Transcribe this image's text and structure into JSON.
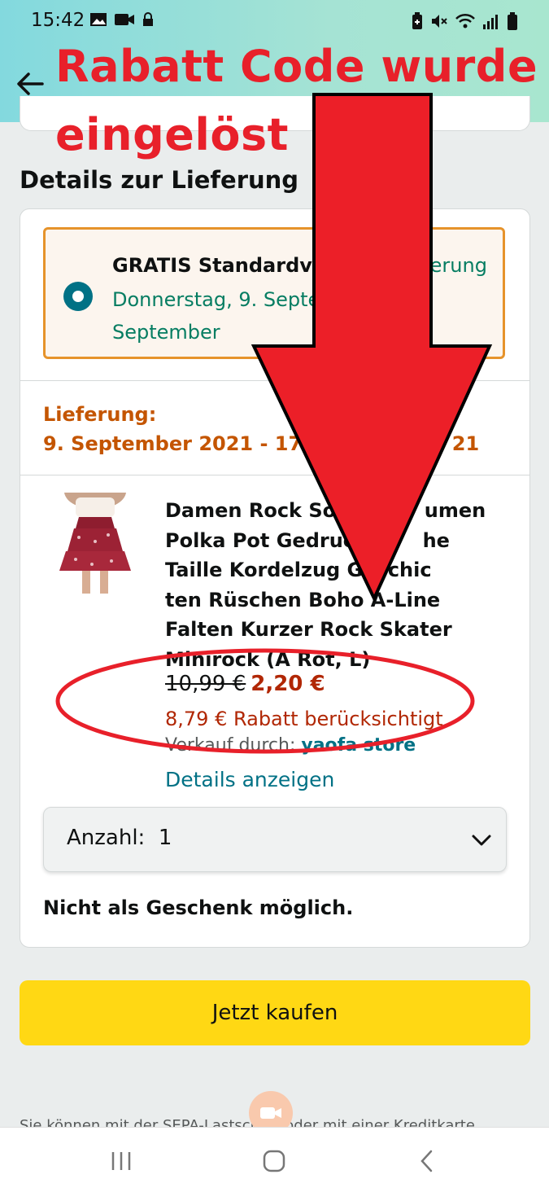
{
  "status_bar": {
    "time": "15:42",
    "left_icons": [
      "image-icon",
      "video-call-icon",
      "lock-icon"
    ],
    "right_icons": [
      "battery-saver-icon",
      "mute-icon",
      "wifi-icon",
      "signal-icon",
      "battery-icon"
    ]
  },
  "annotation": {
    "text": "Rabatt Code wurde eingelöst",
    "color": "#e8202a"
  },
  "section": {
    "title": "Details zur Lieferung"
  },
  "shipping_option": {
    "title": "GRATIS Standardve",
    "title_suffix": "ferung",
    "dates": "Donnerstag, 9. Septe                  tag, 17. September"
  },
  "delivery": {
    "label": "Lieferung:",
    "range": "9. September 2021 - 17.                     21"
  },
  "product": {
    "title": "Damen Rock So             umen Polka Pot Gedruc          he Taille Kordelzug Geschic        ten Rüschen Boho A-Line Falten Kurzer Rock Skater Minirock (A Rot, L)",
    "old_price": "10,99 €",
    "new_price": "2,20 €",
    "discount_text": "8,79 € Rabatt berücksichtigt",
    "seller_prefix": "Verkauf durch:",
    "seller_name": "yaofa store",
    "details_link": "Details anzeigen"
  },
  "quantity": {
    "label": "Anzahl:",
    "value": "1"
  },
  "gift_note": "Nicht als Geschenk möglich.",
  "buy_button": "Jetzt kaufen",
  "footer_text": "Sie können mit der SEPA-Lastschrift oder mit einer Kreditkarte",
  "colors": {
    "header_gradient": "#83d9de",
    "accent_link": "#007185",
    "price_red": "#b12704",
    "delivery_orange": "#c45500",
    "buy_button": "#ffd814",
    "annotation_red": "#e8202a"
  }
}
